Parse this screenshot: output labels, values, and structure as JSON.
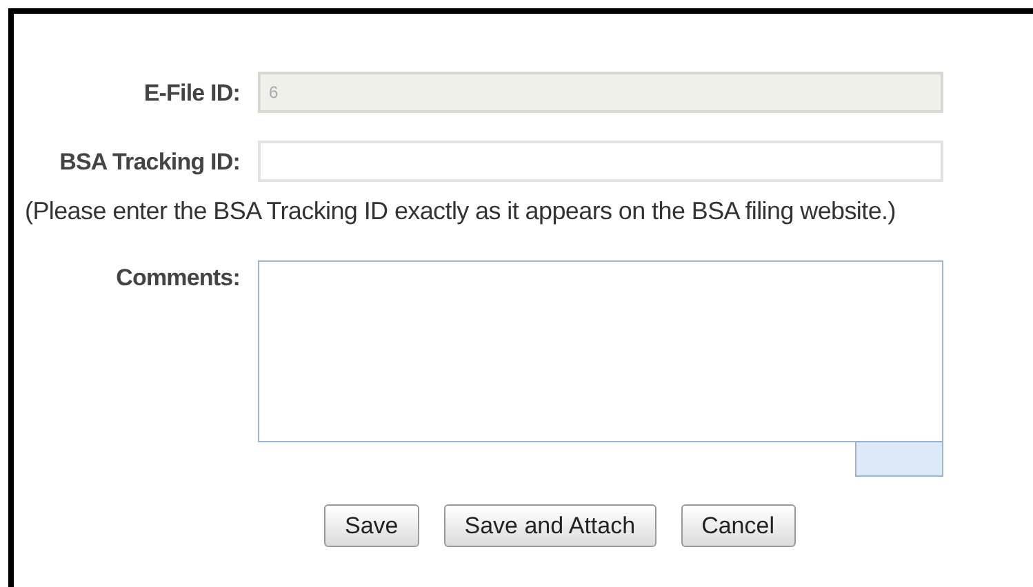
{
  "fields": [
    {
      "label": "E-File ID:",
      "kind": "input",
      "value": "6",
      "disabled": true
    },
    {
      "label": "BSA Tracking ID:",
      "kind": "input",
      "disabled": false
    },
    {
      "kind": "hint",
      "text": "(Please enter the BSA Tracking ID exactly as it appears on the BSA filing website.)"
    },
    {
      "label": "Comments:",
      "kind": "textarea",
      "disabled": false
    }
  ],
  "buttons": [
    "Save",
    "Save and Attach",
    "Cancel"
  ]
}
